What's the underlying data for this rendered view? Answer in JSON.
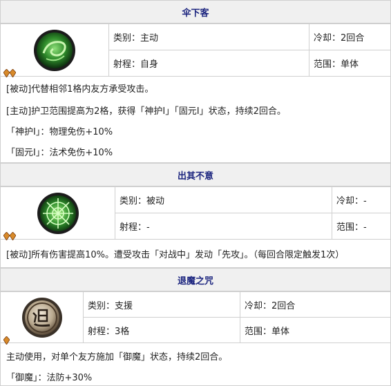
{
  "skills": [
    {
      "name": "伞下客",
      "category": "类别：主动",
      "cooldown": "冷却：2回合",
      "range": "射程：自身",
      "scope": "范围：单体",
      "icon": "swirl-green-skill-icon",
      "lines": [
        "[被动]代替相邻1格内友方承受攻击。",
        "[主动]护卫范围提高为2格，获得「神护Ⅰ」「固元Ⅰ」状态，持续2回合。",
        "「神护Ⅰ」：物理免伤+10%",
        "「固元Ⅰ」：法术免伤+10%"
      ]
    },
    {
      "name": "出其不意",
      "category": "类别：被动",
      "cooldown": "冷却：-",
      "range": "射程：-",
      "scope": "范围：-",
      "icon": "web-green-skill-icon",
      "lines": [
        "[被动]所有伤害提高10%。遭受攻击「对战中」发动「先攻」。（每回合限定触发1次）"
      ]
    },
    {
      "name": "退魔之咒",
      "category": "类别：支援",
      "cooldown": "冷却：2回合",
      "range": "射程：3格",
      "scope": "范围：单体",
      "icon": "tui-seal-skill-icon",
      "lines": [
        "主动使用，对单个友方施加「御魔」状态，持续2回合。",
        "「御魔」：法防+30%"
      ]
    }
  ],
  "colors": {
    "header_text": "#1a237e",
    "header_bg": "#f0f0f0",
    "border": "#cfcfcf"
  }
}
